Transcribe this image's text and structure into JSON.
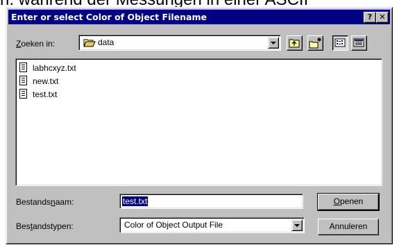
{
  "background_text": "h. während der Messungen in einer ASCII",
  "window": {
    "title": "Enter or select Color of Object Filename",
    "help_button": "?",
    "close_button": "✕"
  },
  "look_in": {
    "label_prefix": "",
    "label_accel": "Z",
    "label_rest": "oeken in:",
    "value": "data"
  },
  "toolbar": {
    "buttons": [
      "up-one-level",
      "create-new-folder",
      "list-view",
      "details-view"
    ]
  },
  "files": [
    {
      "name": "labhcxyz.txt",
      "icon": "text-file-icon"
    },
    {
      "name": "new.txt",
      "icon": "text-file-icon"
    },
    {
      "name": "test.txt",
      "icon": "text-file-icon"
    }
  ],
  "filename": {
    "label_prefix": "Bestands",
    "label_accel": "n",
    "label_rest": "aam:",
    "value": "test.txt"
  },
  "filetype": {
    "label_prefix": "Bes",
    "label_accel": "t",
    "label_rest": "andstypen:",
    "value": "Color of Object Output File"
  },
  "buttons": {
    "open_accel": "O",
    "open_rest": "penen",
    "cancel": "Annuleren"
  },
  "colors": {
    "titlebar": "#000080",
    "dialog": "#c0c0c0",
    "selection": "#000080"
  }
}
